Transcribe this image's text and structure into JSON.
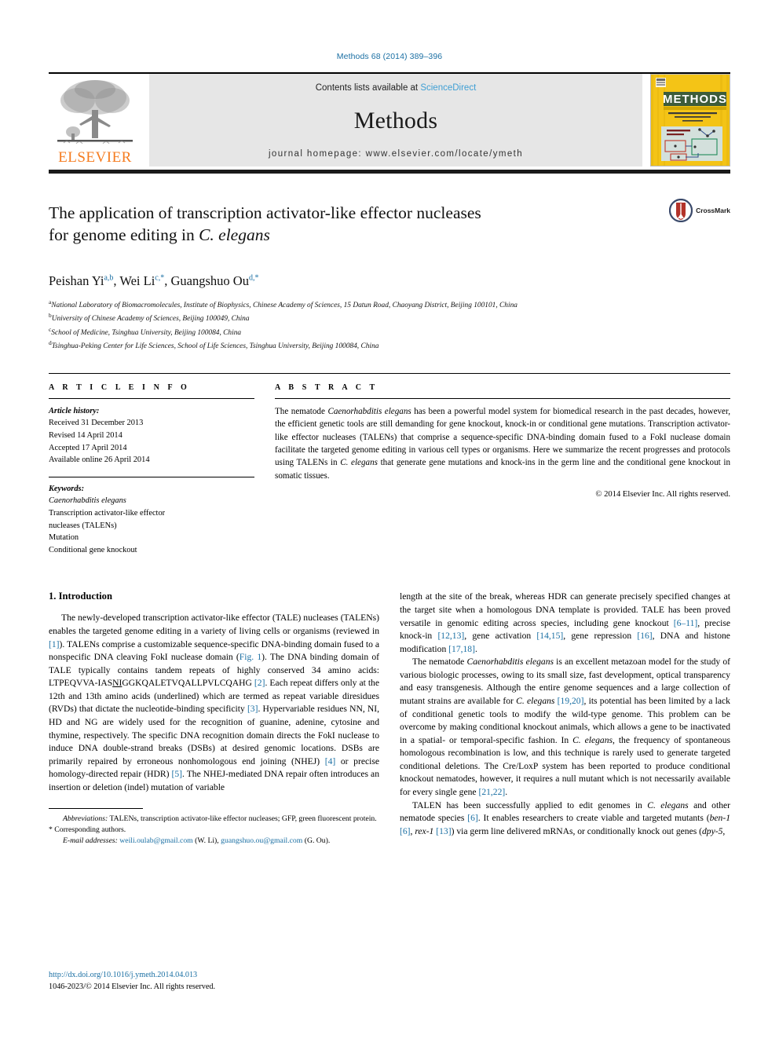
{
  "running_head": "Methods 68 (2014) 389–396",
  "masthead": {
    "publisher": "ELSEVIER",
    "contents_prefix": "Contents lists available at ",
    "contents_link": "ScienceDirect",
    "journal_title": "Methods",
    "homepage": "journal homepage: www.elsevier.com/locate/ymeth",
    "cover_title": "METHODS",
    "cover_subtitle": "A COMPANION TO METHODS IN ENZYMOLOGY",
    "cover_editors": "Editor-in-Chief: Michael Fitzgerald Christiansen",
    "cover_section": "SYSTEMS BIOLOGY"
  },
  "article": {
    "title_line1": "The application of transcription activator-like effector nucleases",
    "title_line2_plain": "for genome editing in ",
    "title_line2_italic": "C. elegans",
    "crossmark_label": "CrossMark",
    "authors_html": "Peishan Yi a,b, Wei Li c,*, Guangshuo Ou d,*",
    "authors": [
      {
        "name": "Peishan Yi",
        "sup": "a,b"
      },
      {
        "name": "Wei Li",
        "sup": "c,*"
      },
      {
        "name": "Guangshuo Ou",
        "sup": "d,*"
      }
    ],
    "affiliations": [
      {
        "sup": "a",
        "text": "National Laboratory of Biomacromolecules, Institute of Biophysics, Chinese Academy of Sciences, 15 Datun Road, Chaoyang District, Beijing 100101, China"
      },
      {
        "sup": "b",
        "text": "University of Chinese Academy of Sciences, Beijing 100049, China"
      },
      {
        "sup": "c",
        "text": "School of Medicine, Tsinghua University, Beijing 100084, China"
      },
      {
        "sup": "d",
        "text": "Tsinghua-Peking Center for Life Sciences, School of Life Sciences, Tsinghua University, Beijing 100084, China"
      }
    ]
  },
  "info": {
    "heading": "A R T I C L E    I N F O",
    "history_label": "Article history:",
    "history": [
      "Received 31 December 2013",
      "Revised 14 April 2014",
      "Accepted 17 April 2014",
      "Available online 26 April 2014"
    ],
    "keywords_label": "Keywords:",
    "keywords": [
      "Caenorhabditis elegans",
      "Transcription activator-like effector",
      "nucleases (TALENs)",
      "Mutation",
      "Conditional gene knockout"
    ]
  },
  "abstract": {
    "heading": "A B S T R A C T",
    "text": "The nematode Caenorhabditis elegans has been a powerful model system for biomedical research in the past decades, however, the efficient genetic tools are still demanding for gene knockout, knock-in or conditional gene mutations. Transcription activator-like effector nucleases (TALENs) that comprise a sequence-specific DNA-binding domain fused to a FokI nuclease domain facilitate the targeted genome editing in various cell types or organisms. Here we summarize the recent progresses and protocols using TALENs in C. elegans that generate gene mutations and knock-ins in the germ line and the conditional gene knockout in somatic tissues.",
    "copyright": "© 2014 Elsevier Inc. All rights reserved."
  },
  "body": {
    "section_title": "1. Introduction",
    "left_paragraph_1": "The newly-developed transcription activator-like effector (TALE) nucleases (TALENs) enables the targeted genome editing in a variety of living cells or organisms (reviewed in [1]). TALENs comprise a customizable sequence-specific DNA-binding domain fused to a nonspecific DNA cleaving FokI nuclease domain (Fig. 1). The DNA binding domain of TALE typically contains tandem repeats of highly conserved 34 amino acids: LTPEQVVAIASNIGGKQALETVQALLPVLCQAHG [2]. Each repeat differs only at the 12th and 13th amino acids (underlined) which are termed as repeat variable diresidues (RVDs) that dictate the nucleotide-binding specificity [3]. Hypervariable residues NN, NI, HD and NG are widely used for the recognition of guanine, adenine, cytosine and thymine, respectively. The specific DNA recognition domain directs the FokI nuclease to induce DNA double-strand breaks (DSBs) at desired genomic locations. DSBs are primarily repaired by erroneous nonhomologous end joining (NHEJ) [4] or precise homology-directed repair (HDR) [5]. The NHEJ-mediated DNA repair often introduces an insertion or deletion (indel) mutation of variable",
    "right_paragraph_1": "length at the site of the break, whereas HDR can generate precisely specified changes at the target site when a homologous DNA template is provided. TALE has been proved versatile in genomic editing across species, including gene knockout [6–11], precise knock-in [12,13], gene activation [14,15], gene repression [16], DNA and histone modification [17,18].",
    "right_paragraph_2": "The nematode Caenorhabditis elegans is an excellent metazoan model for the study of various biologic processes, owing to its small size, fast development, optical transparency and easy transgenesis. Although the entire genome sequences and a large collection of mutant strains are available for C. elegans [19,20], its potential has been limited by a lack of conditional genetic tools to modify the wild-type genome. This problem can be overcome by making conditional knockout animals, which allows a gene to be inactivated in a spatial- or temporal-specific fashion. In C. elegans, the frequency of spontaneous homologous recombination is low, and this technique is rarely used to generate targeted conditional deletions. The Cre/LoxP system has been reported to produce conditional knockout nematodes, however, it requires a null mutant which is not necessarily available for every single gene [21,22].",
    "right_paragraph_3": "TALEN has been successfully applied to edit genomes in C. elegans and other nematode species [6]. It enables researchers to create viable and targeted mutants (ben-1 [6], rex-1 [13]) via germ line delivered mRNAs, or conditionally knock out genes (dpy-5,"
  },
  "footnotes": {
    "abbreviations_label": "Abbreviations:",
    "abbreviations_text": "TALENs, transcription activator-like effector nucleases; GFP, green fluorescent protein.",
    "corresponding": "* Corresponding authors.",
    "email_label": "E-mail addresses:",
    "email_1": "weili.oulab@gmail.com",
    "email_1_who": "(W. Li),",
    "email_2": "guangshuo.ou@gmail.com",
    "email_2_who": "(G. Ou)."
  },
  "footer": {
    "doi": "http://dx.doi.org/10.1016/j.ymeth.2014.04.013",
    "issn_line": "1046-2023/© 2014 Elsevier Inc. All rights reserved."
  },
  "colors": {
    "link_blue": "#1a6fa3",
    "sciencedirect_blue": "#3f9fd4",
    "elsevier_orange": "#F57C20",
    "masthead_grey": "#e6e6e6",
    "cover_yellow": "#f6c920",
    "crossmark_red": "#b3332a"
  }
}
